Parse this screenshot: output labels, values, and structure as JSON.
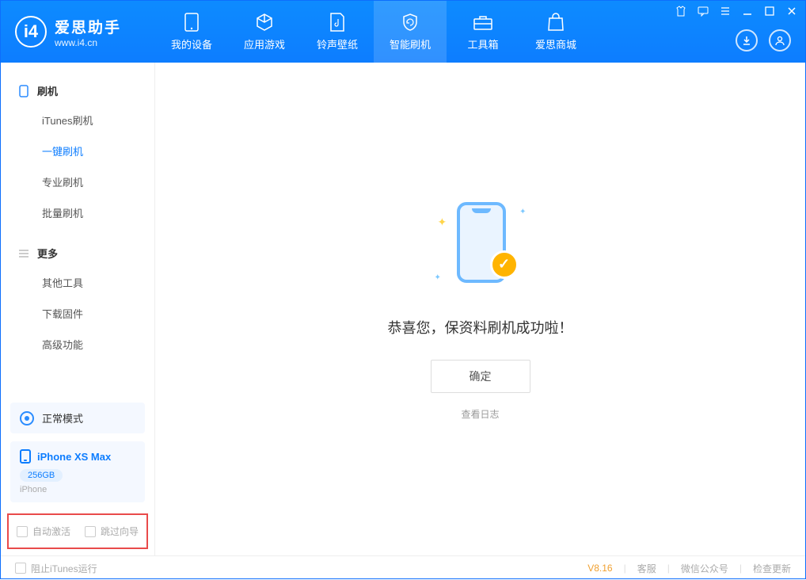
{
  "app": {
    "title": "爱思助手",
    "url": "www.i4.cn"
  },
  "nav": {
    "tabs": [
      {
        "label": "我的设备"
      },
      {
        "label": "应用游戏"
      },
      {
        "label": "铃声壁纸"
      },
      {
        "label": "智能刷机"
      },
      {
        "label": "工具箱"
      },
      {
        "label": "爱思商城"
      }
    ]
  },
  "sidebar": {
    "flash_heading": "刷机",
    "flash_items": [
      "iTunes刷机",
      "一键刷机",
      "专业刷机",
      "批量刷机"
    ],
    "more_heading": "更多",
    "more_items": [
      "其他工具",
      "下载固件",
      "高级功能"
    ]
  },
  "status": {
    "mode": "正常模式"
  },
  "device": {
    "name": "iPhone XS Max",
    "storage": "256GB",
    "os": "iPhone"
  },
  "options": {
    "auto_activate": "自动激活",
    "skip_guide": "跳过向导"
  },
  "main": {
    "success_text": "恭喜您，保资料刷机成功啦！",
    "confirm": "确定",
    "view_log": "查看日志"
  },
  "footer": {
    "block_itunes": "阻止iTunes运行",
    "version": "V8.16",
    "support": "客服",
    "wechat": "微信公众号",
    "update": "检查更新"
  }
}
